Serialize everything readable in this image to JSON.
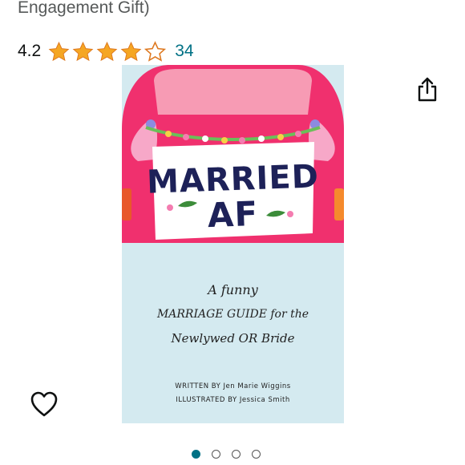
{
  "product": {
    "title_fragment": "Engagement Gift)",
    "rating": "4.2",
    "stars_filled": 4,
    "stars_total": 5,
    "review_count": "34"
  },
  "book_cover": {
    "sign_line1": "MARRIED",
    "sign_line2": "AF",
    "tagline_line1": "A funny",
    "tagline_line2": "MARRIAGE GUIDE for the",
    "tagline_line3": "Newlywed OR Bride",
    "written_by": "WRITTEN BY Jen Marie Wiggins",
    "illustrated_by": "ILLUSTRATED BY Jessica Smith"
  },
  "icons": {
    "share": "share-icon",
    "wishlist": "heart-icon"
  },
  "carousel": {
    "total": 4,
    "active_index": 0
  },
  "colors": {
    "star": "#f5a623",
    "link": "#007185",
    "car": "#f0306e",
    "cover_bg": "#d4eaf0",
    "sign_text": "#1d2158"
  }
}
